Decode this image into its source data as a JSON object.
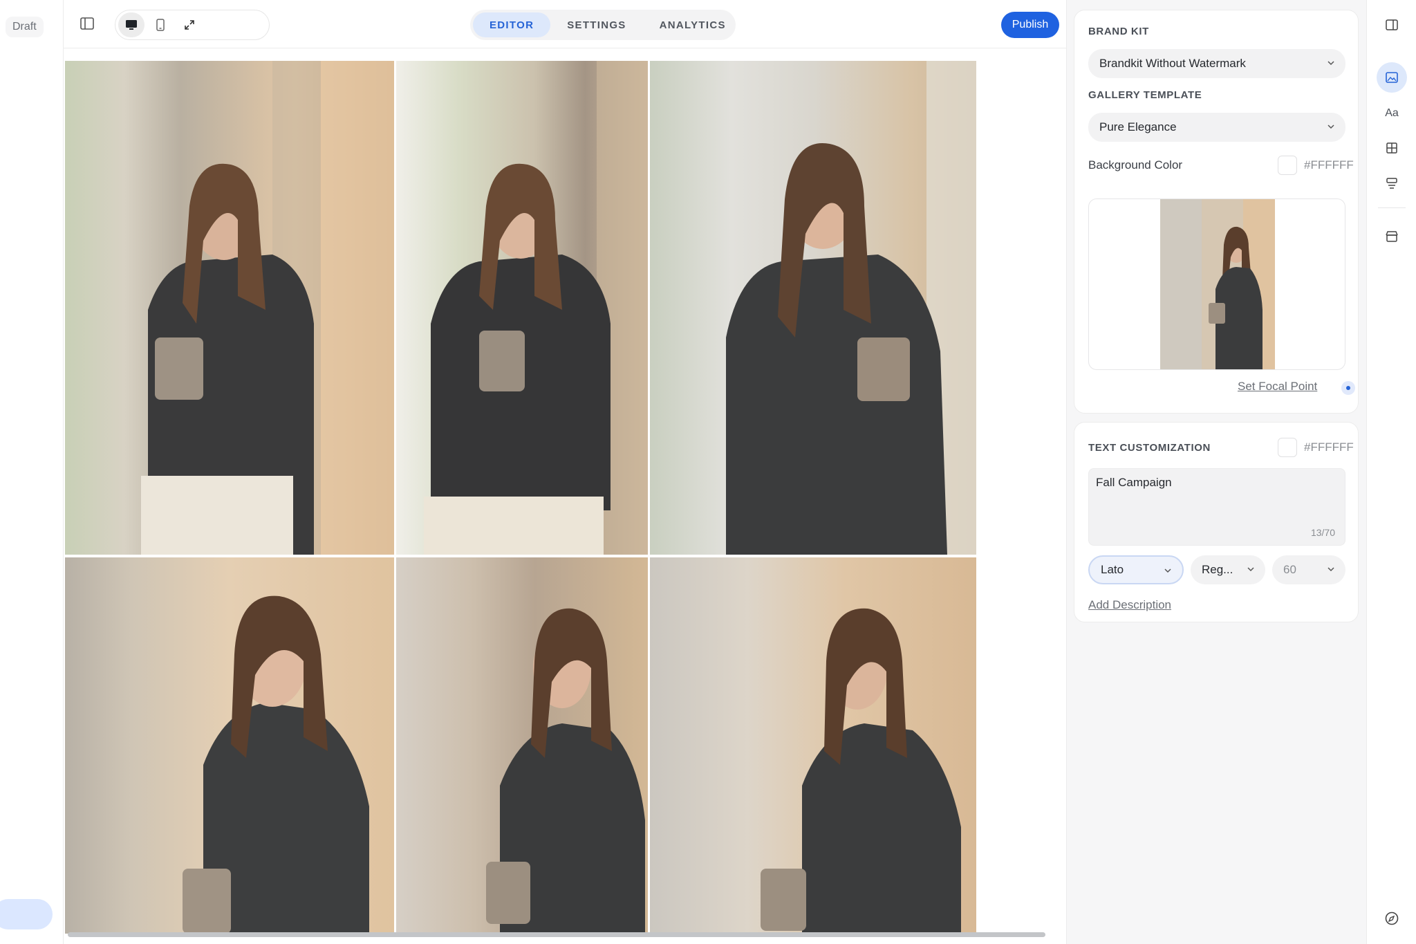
{
  "left": {
    "status": "Draft"
  },
  "header": {
    "tabs": [
      {
        "label": "EDITOR",
        "active": true
      },
      {
        "label": "SETTINGS",
        "active": false
      },
      {
        "label": "ANALYTICS",
        "active": false
      }
    ],
    "publish_label": "Publish",
    "device_buttons": [
      "desktop-icon",
      "mobile-icon",
      "fullscreen-icon"
    ]
  },
  "gallery": {
    "photos": [
      {
        "name": "portrait-1"
      },
      {
        "name": "portrait-2"
      },
      {
        "name": "portrait-3"
      },
      {
        "name": "portrait-4"
      },
      {
        "name": "portrait-5"
      },
      {
        "name": "portrait-6"
      }
    ]
  },
  "panel": {
    "brand_kit_label": "BRAND KIT",
    "brand_kit_value": "Brandkit Without Watermark",
    "gallery_template_label": "GALLERY TEMPLATE",
    "gallery_template_value": "Pure Elegance",
    "background_color_label": "Background Color",
    "background_color_value": "#FFFFFF",
    "set_focal_point": "Set Focal Point",
    "text_customization_label": "TEXT CUSTOMIZATION",
    "text_color_value": "#FFFFFF",
    "text_value": "Fall Campaign",
    "char_count": "13/70",
    "font_family": "Lato",
    "font_weight": "Reg...",
    "font_size": "60",
    "add_description": "Add Description"
  },
  "rail": {
    "icons": [
      "panel-toggle-icon",
      "image-icon",
      "typography-icon",
      "layout-grid-icon",
      "sections-icon",
      "store-icon",
      "compass-icon"
    ],
    "typography_glyph": "Aa"
  },
  "colors": {
    "accent": "#1f62e0",
    "accent_soft": "#dde8fb",
    "panel_bg": "#f6f6f7"
  }
}
